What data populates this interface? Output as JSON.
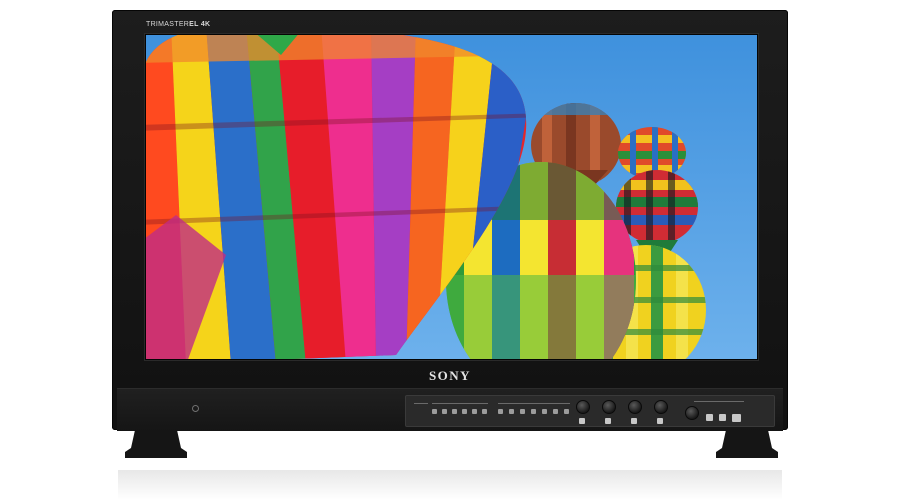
{
  "product": {
    "model_prefix": "TRIMASTER",
    "model_suffix": "EL 4K",
    "brand": "SONY"
  },
  "colors": {
    "bezel": "#141414",
    "sky": "#3d8fd8",
    "logo": "#e4e4e4"
  },
  "icons": {
    "power": "power-led-icon"
  }
}
